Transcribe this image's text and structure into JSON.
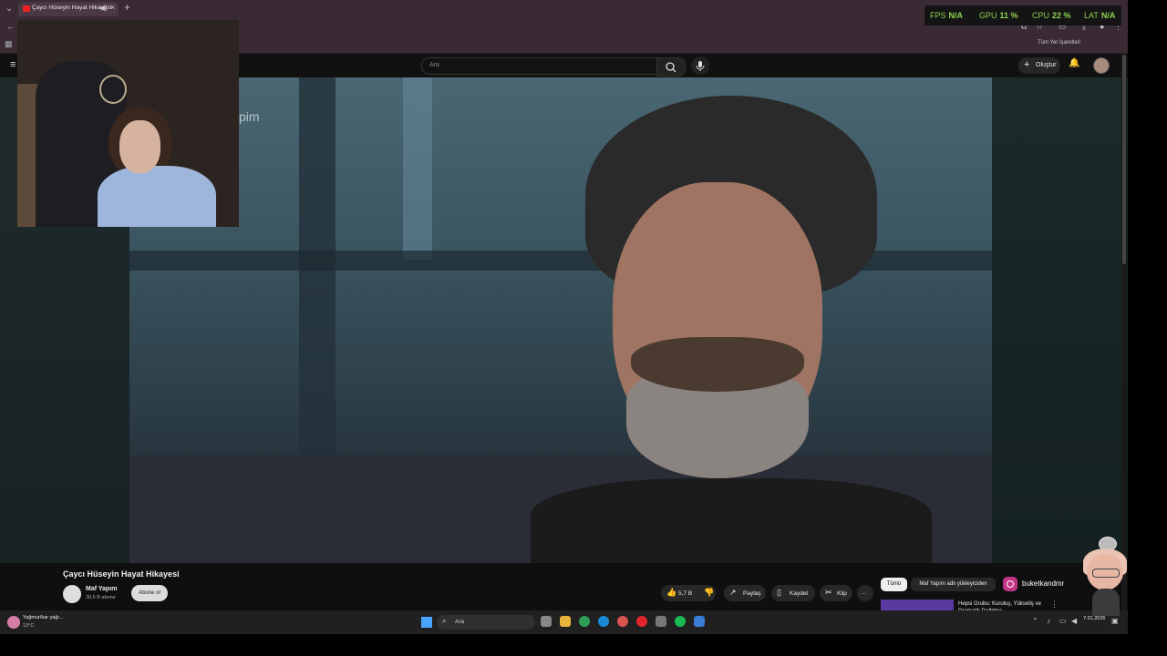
{
  "browser": {
    "tab_title": "Çaycı Hüseyin Hayat Hikayesi",
    "audio_icon": "speaker-icon",
    "new_tab_label": "+",
    "bookmarks_right_label": "Tüm Yer İşaretleri"
  },
  "overlay_stats": {
    "fps_label": "FPS",
    "fps_value": "N/A",
    "gpu_label": "GPU",
    "gpu_value": "11 %",
    "cpu_label": "CPU",
    "cpu_value": "22 %",
    "lat_label": "LAT",
    "lat_value": "N/A",
    "accent": "#8fd14f"
  },
  "youtube": {
    "search_placeholder": "Ara",
    "create_label": "Oluştur",
    "video_watermark": "pim",
    "video_title": "Çaycı Hüseyin Hayat Hikayesi",
    "channel_name": "Maf Yapım",
    "channel_subs": "30,6 B abone",
    "subscribe_label": "Abone ol",
    "like_count": "5,7 B",
    "share_label": "Paylaş",
    "save_label": "Kaydet",
    "clip_label": "Klip",
    "more_label": "···",
    "filter_all": "Tümü",
    "filter_uploader": "Maf Yapım adlı yükleyiciden",
    "rec_title": "Hepsi Grubu: Kuruluş, Yükseliş ve Dramatik Dağılma",
    "instagram_handle": "buketkandmr"
  },
  "taskbar": {
    "weather_line1": "Yağmur/kar yağı...",
    "weather_line2": "13°C",
    "search_placeholder": "Ara",
    "time": "",
    "date": "7.01.2026"
  }
}
